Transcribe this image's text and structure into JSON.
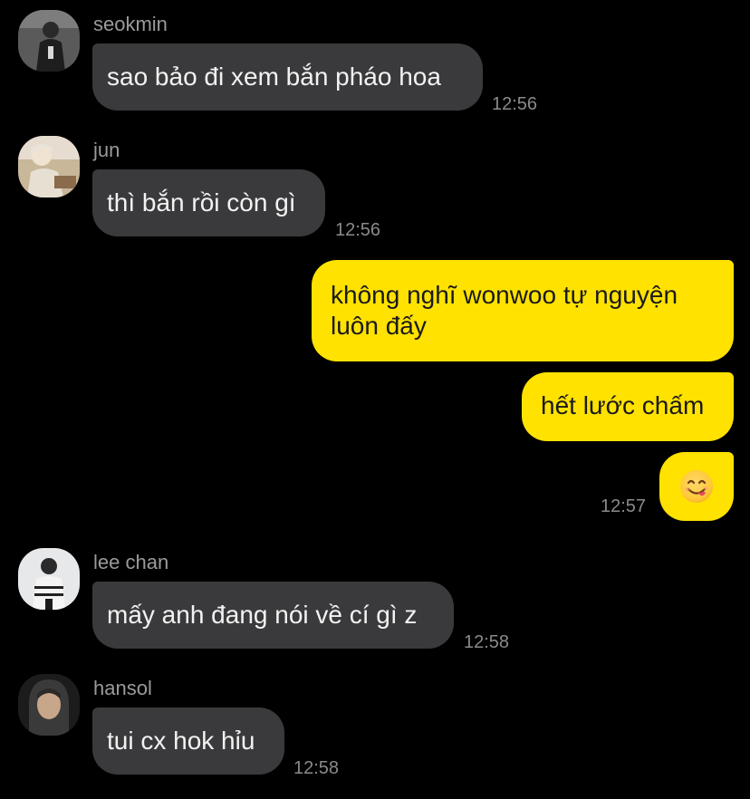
{
  "messages": [
    {
      "sender": "seokmin",
      "text": "sao bảo đi xem bắn pháo hoa",
      "time": "12:56"
    },
    {
      "sender": "jun",
      "text": "thì bắn rồi còn gì",
      "time": "12:56"
    },
    {
      "sender": "me",
      "text_line1": "không nghĩ wonwoo tự nguyện",
      "text_line2": "luôn đấy"
    },
    {
      "sender": "me",
      "text": "hết lước chấm"
    },
    {
      "sender": "me",
      "emoji": "yum-face-emoji",
      "time": "12:57"
    },
    {
      "sender": "lee chan",
      "text": "mấy anh đang nói về cí gì z",
      "time": "12:58"
    },
    {
      "sender": "hansol",
      "text": "tui cx hok hỉu",
      "time": "12:58"
    }
  ],
  "colors": {
    "background": "#000000",
    "incoming_bubble": "#3a3a3c",
    "outgoing_bubble": "#ffe200",
    "timestamp": "#8a8a8a",
    "sender_name": "#9a9a9a"
  }
}
